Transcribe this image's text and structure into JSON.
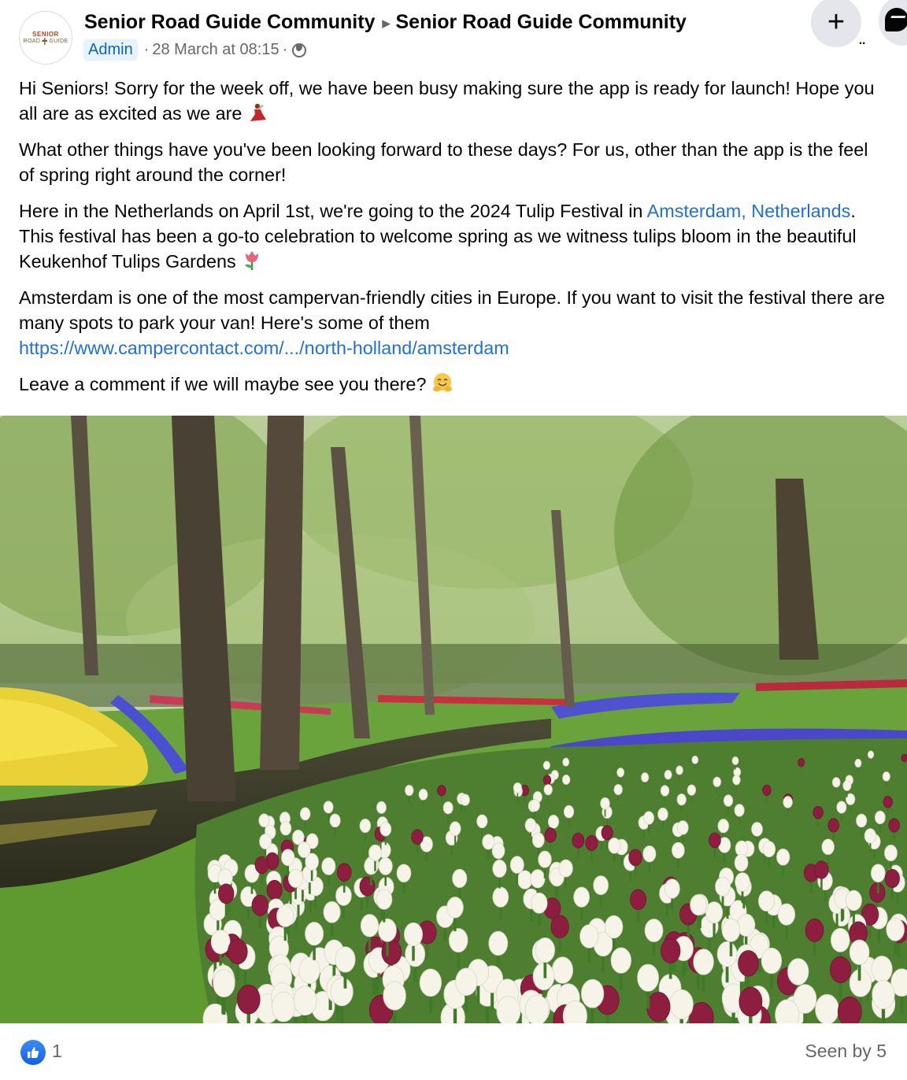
{
  "header": {
    "avatar_top": "SENIOR",
    "avatar_bottom_left": "ROAD",
    "avatar_bottom_right": "GUIDE",
    "author": "Senior Road Guide Community",
    "group": "Senior Road Guide Community",
    "role_badge": "Admin",
    "timestamp": "28 March at 08:15",
    "separator": "·",
    "plus_label": "+",
    "more_label": "..",
    "privacy_icon": "globe-icon"
  },
  "post": {
    "p1_text": "Hi Seniors! Sorry for the week off, we have been busy making sure the app is ready for launch! Hope you all are as excited as we are",
    "p1_emoji": "dancer-emoji",
    "p2_text": "What other things have you've been looking forward to these days? For us, other than the app is the feel of spring right around the corner!",
    "p3_pre": "Here in the Netherlands on April 1st, we're going to the 2024 Tulip Festival in ",
    "p3_link": "Amsterdam, Netherlands",
    "p3_post": ". This festival has been a go-to celebration to welcome spring as we witness tulips bloom in the beautiful Keukenhof Tulips Gardens",
    "p3_emoji": "tulip-emoji",
    "p4_text": "Amsterdam is one of the most campervan-friendly cities in Europe. If you want to visit the festival there are many spots to park your van! Here's some of them",
    "p4_link": "https://www.campercontact.com/.../north-holland/amsterdam",
    "p5_text": "Leave a comment if we will maybe see you there?",
    "p5_emoji": "hugging-face-emoji"
  },
  "footer": {
    "like_count": "1",
    "seen_by": "Seen by 5"
  },
  "colors": {
    "link": "#216fdb",
    "badge_bg": "#e7f3ff",
    "badge_text": "#0a66c2",
    "like_blue": "#1877f2"
  }
}
